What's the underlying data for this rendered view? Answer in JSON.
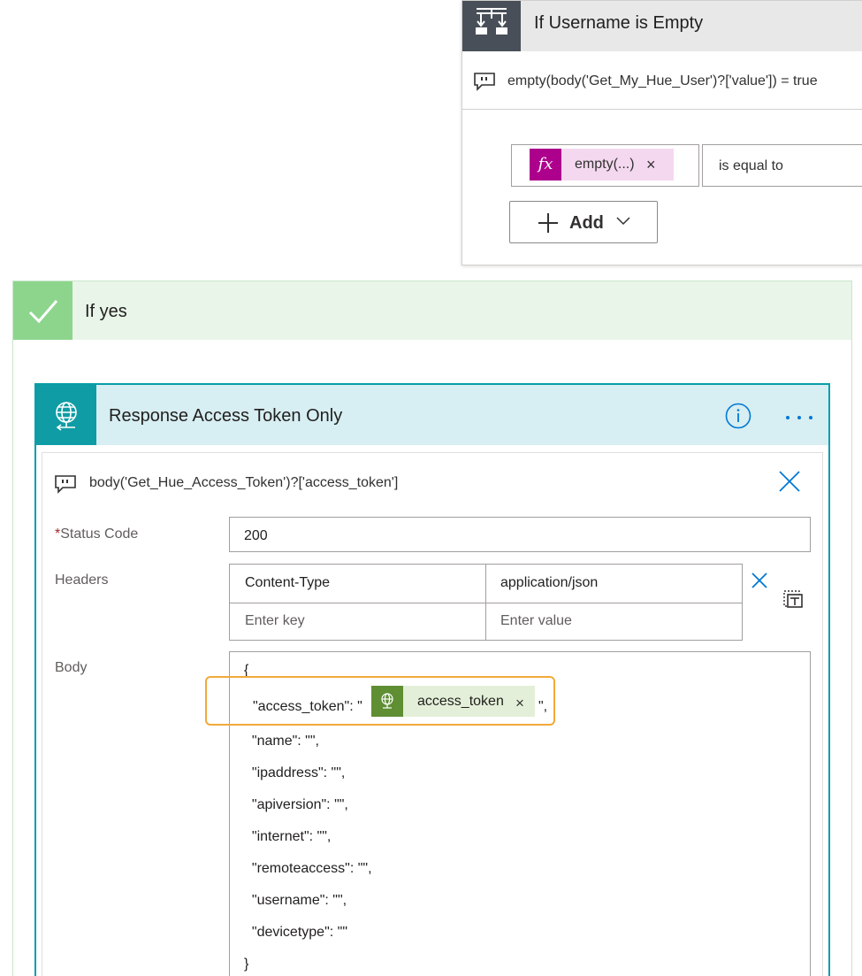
{
  "condition": {
    "title": "If Username is Empty",
    "expression": "empty(body('Get_My_Hue_User')?['value']) = true",
    "token_label": "empty(...)",
    "token_badge": "fx",
    "token_close": "×",
    "operator": "is equal to",
    "add_label": "Add",
    "add_plus": "+",
    "icon": "condition-icon"
  },
  "if_yes": {
    "label": "If yes",
    "icon": "checkmark-icon"
  },
  "response": {
    "title": "Response Access Token Only",
    "expression": "body('Get_Hue_Access_Token')?['access_token']",
    "status_code": {
      "required_mark": "*",
      "label": "Status Code",
      "value": "200"
    },
    "headers": {
      "label": "Headers",
      "rows": [
        {
          "key": "Content-Type",
          "value": "application/json"
        }
      ],
      "key_placeholder": "Enter key",
      "value_placeholder": "Enter value"
    },
    "body": {
      "label": "Body",
      "lines": [
        "{",
        "  \"name\": \"\",",
        "  \"ipaddress\": \"\",",
        "  \"apiversion\": \"\",",
        "  \"internet\": \"\",",
        "  \"remoteaccess\": \"\",",
        "  \"username\": \"\",",
        "  \"devicetype\": \"\"",
        "}"
      ],
      "token_line_prefix": "\"access_token\": \"",
      "token_line_suffix": "\",",
      "token_label": "access_token",
      "token_close": "×"
    }
  },
  "colors": {
    "condition_icon_bg": "#484f58",
    "fx_badge": "#ad008c",
    "fx_token_bg": "#f4d8ef",
    "yes_icon_bg": "#8dd58d",
    "yes_header_bg": "#e9f5e9",
    "response_icon_bg": "#0f9ca5",
    "response_header_bg": "#d7eef2",
    "response_border": "#089ea7",
    "access_token_badge": "#5f8e33",
    "highlight": "#f2a93b",
    "accent_blue": "#0078d4"
  }
}
